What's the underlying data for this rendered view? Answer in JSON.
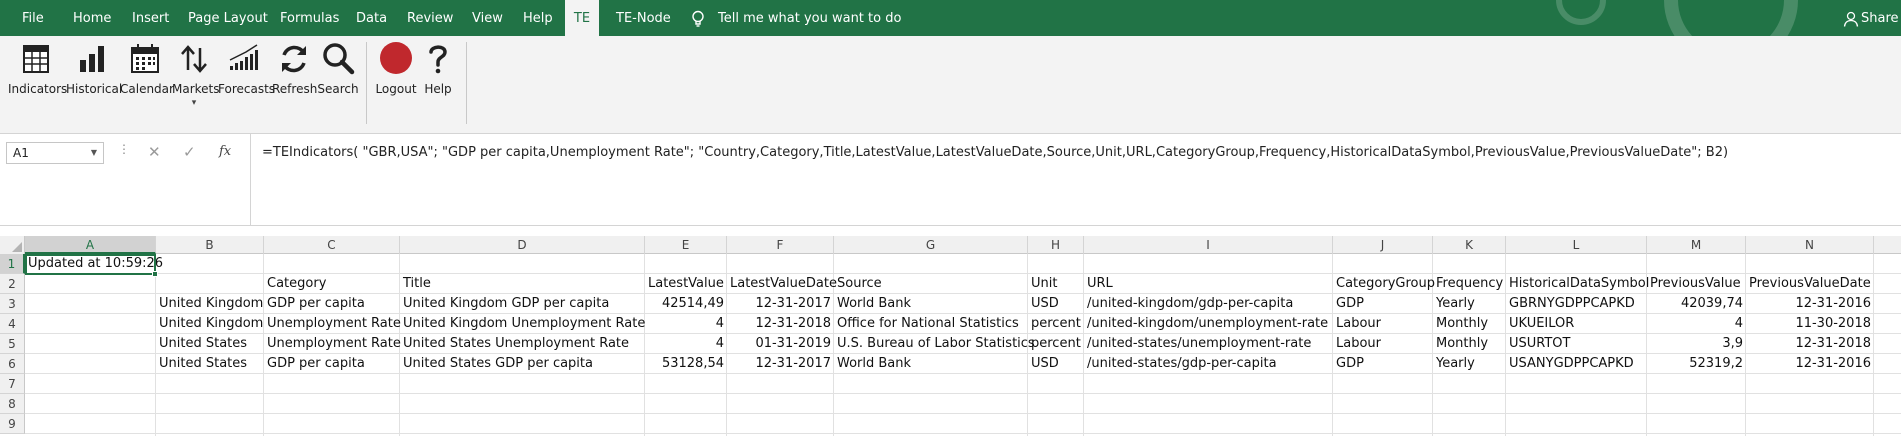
{
  "menu": {
    "tabs": [
      "File",
      "Home",
      "Insert",
      "Page Layout",
      "Formulas",
      "Data",
      "Review",
      "View",
      "Help",
      "TE",
      "TE-Node"
    ],
    "active_tab": "TE",
    "tell_me": "Tell me what you want to do",
    "share": "Share"
  },
  "ribbon": {
    "buttons": [
      {
        "label": "Indicators",
        "icon": "indicators-table-icon"
      },
      {
        "label": "Historical",
        "icon": "bar-chart-icon"
      },
      {
        "label": "Calendar",
        "icon": "calendar-icon"
      },
      {
        "label": "Markets",
        "icon": "up-down-arrows-icon",
        "has_dropdown": true
      },
      {
        "label": "Forecasts",
        "icon": "forecast-trend-icon"
      },
      {
        "label": "Refresh",
        "icon": "refresh-icon"
      },
      {
        "label": "Search",
        "icon": "search-icon"
      },
      {
        "label": "Logout",
        "icon": "logout-red-circle-icon"
      },
      {
        "label": "Help",
        "icon": "question-mark-icon"
      }
    ]
  },
  "formula_bar": {
    "name_box": "A1",
    "cancel_symbol": "✕",
    "enter_symbol": "✓",
    "fx": "fx",
    "formula": "=TEIndicators( \"GBR,USA\"; \"GDP per capita,Unemployment Rate\"; \"Country,Category,Title,LatestValue,LatestValueDate,Source,Unit,URL,CategoryGroup,Frequency,HistoricalDataSymbol,PreviousValue,PreviousValueDate\"; B2)"
  },
  "sheet": {
    "columns": [
      "A",
      "B",
      "C",
      "D",
      "E",
      "F",
      "G",
      "H",
      "I",
      "J",
      "K",
      "L",
      "M",
      "N"
    ],
    "selected_column": "A",
    "rows": [
      "1",
      "2",
      "3",
      "4",
      "5",
      "6",
      "7",
      "8",
      "9"
    ],
    "selected_row": "1",
    "a1": "Updated at 10:59:26",
    "headers": [
      "Category",
      "Title",
      "LatestValue",
      "LatestValueDate",
      "Source",
      "Unit",
      "URL",
      "CategoryGroup",
      "Frequency",
      "HistoricalDataSymbol",
      "PreviousValue",
      "PreviousValueDate"
    ],
    "data": [
      [
        "United Kingdom",
        "GDP per capita",
        "United Kingdom GDP per capita",
        "42514,49",
        "12-31-2017",
        "World Bank",
        "USD",
        "/united-kingdom/gdp-per-capita",
        "GDP",
        "Yearly",
        "GBRNYGDPPCAPKD",
        "42039,74",
        "12-31-2016"
      ],
      [
        "United Kingdom",
        "Unemployment Rate",
        "United Kingdom Unemployment Rate",
        "4",
        "12-31-2018",
        "Office for National Statistics",
        "percent",
        "/united-kingdom/unemployment-rate",
        "Labour",
        "Monthly",
        "UKUEILOR",
        "4",
        "11-30-2018"
      ],
      [
        "United States",
        "Unemployment Rate",
        "United States Unemployment Rate",
        "4",
        "01-31-2019",
        "U.S. Bureau of Labor Statistics",
        "percent",
        "/united-states/unemployment-rate",
        "Labour",
        "Monthly",
        "USURTOT",
        "3,9",
        "12-31-2018"
      ],
      [
        "United States",
        "GDP per capita",
        "United States GDP per capita",
        "53128,54",
        "12-31-2017",
        "World Bank",
        "USD",
        "/united-states/gdp-per-capita",
        "GDP",
        "Yearly",
        "USANYGDPPCAPKD",
        "52319,2",
        "12-31-2016"
      ]
    ]
  },
  "colors": {
    "excel_green": "#217346",
    "logout_red": "#c0282d"
  }
}
